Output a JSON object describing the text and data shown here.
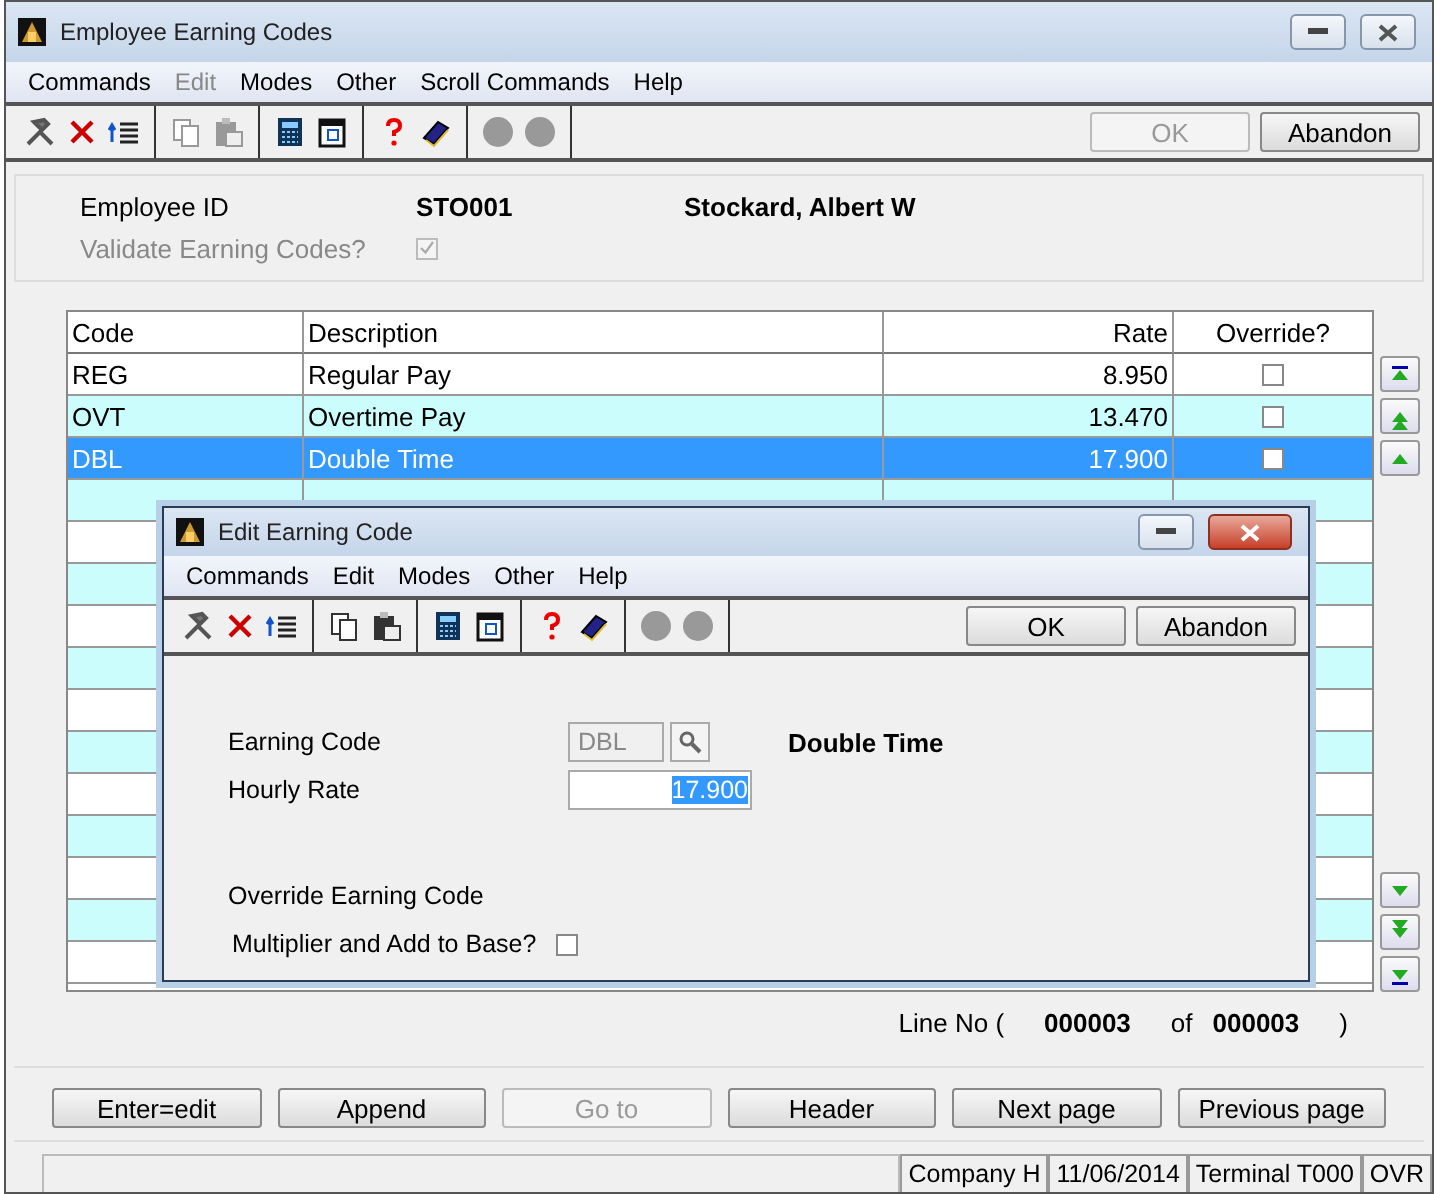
{
  "window": {
    "title": "Employee Earning Codes"
  },
  "menu": [
    {
      "label": "Commands",
      "disabled": false
    },
    {
      "label": "Edit",
      "disabled": true
    },
    {
      "label": "Modes",
      "disabled": false
    },
    {
      "label": "Other",
      "disabled": false
    },
    {
      "label": "Scroll Commands",
      "disabled": false
    },
    {
      "label": "Help",
      "disabled": false
    }
  ],
  "toolbar_buttons": [
    {
      "label": "OK",
      "disabled": true
    },
    {
      "label": "Abandon",
      "disabled": false
    }
  ],
  "header": {
    "employee_id_label": "Employee ID",
    "employee_id": "STO001",
    "employee_name": "Stockard, Albert W",
    "validate_label": "Validate Earning Codes?",
    "validate_checked": true,
    "validate_disabled": true
  },
  "table": {
    "columns": [
      "Code",
      "Description",
      "Rate",
      "Override?"
    ],
    "rows": [
      {
        "code": "REG",
        "description": "Regular Pay",
        "rate": "8.950",
        "override": false,
        "selected": false
      },
      {
        "code": "OVT",
        "description": "Overtime Pay",
        "rate": "13.470",
        "override": false,
        "selected": false
      },
      {
        "code": "DBL",
        "description": "Double Time",
        "rate": "17.900",
        "override": false,
        "selected": true
      }
    ]
  },
  "line_no": {
    "label": "Line No (",
    "current": "000003",
    "of": "of",
    "total": "000003",
    "close": ")"
  },
  "buttons": [
    {
      "label": "Enter=edit",
      "disabled": false
    },
    {
      "label": "Append",
      "disabled": false
    },
    {
      "label": "Go to",
      "disabled": true
    },
    {
      "label": "Header",
      "disabled": false
    },
    {
      "label": "Next page",
      "disabled": false
    },
    {
      "label": "Previous page",
      "disabled": false
    }
  ],
  "status_bar": [
    "Company H",
    "11/06/2014",
    "Terminal T000",
    "OVR"
  ],
  "dialog": {
    "title": "Edit Earning Code",
    "menu": [
      {
        "label": "Commands",
        "disabled": false
      },
      {
        "label": "Edit",
        "disabled": false
      },
      {
        "label": "Modes",
        "disabled": false
      },
      {
        "label": "Other",
        "disabled": false
      },
      {
        "label": "Help",
        "disabled": false
      }
    ],
    "toolbar_buttons": [
      {
        "label": "OK",
        "disabled": false
      },
      {
        "label": "Abandon",
        "disabled": false
      }
    ],
    "earning_code_label": "Earning Code",
    "earning_code": "DBL",
    "earning_code_name": "Double Time",
    "hourly_rate_label": "Hourly Rate",
    "hourly_rate": "17.900",
    "override_label": "Override Earning Code",
    "multiplier_label": "Multiplier and Add to Base?",
    "multiplier_checked": false
  }
}
